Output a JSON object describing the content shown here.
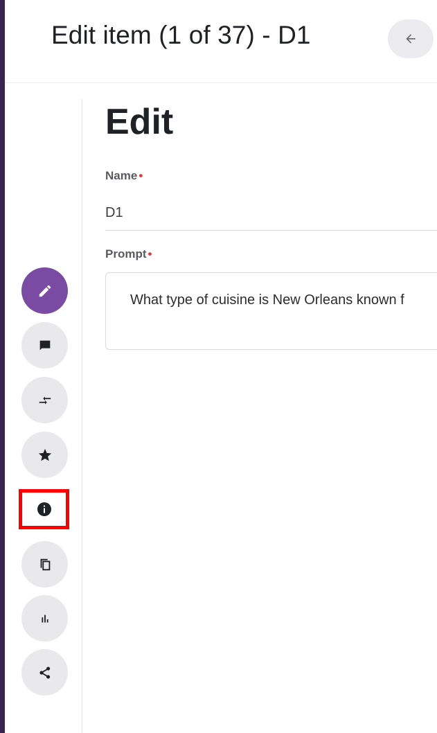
{
  "header": {
    "title": "Edit item (1 of 37) - D1",
    "back_icon": "arrow-left-icon"
  },
  "form": {
    "heading": "Edit",
    "name_label": "Name",
    "name_value": "D1",
    "prompt_label": "Prompt",
    "prompt_value": "What type of cuisine is New Orleans known f",
    "required_marker": "•"
  },
  "rail": {
    "items": [
      {
        "icon": "pencil-icon",
        "active": true
      },
      {
        "icon": "comment-icon",
        "active": false
      },
      {
        "icon": "compare-arrows-icon",
        "active": false
      },
      {
        "icon": "star-icon",
        "active": false
      },
      {
        "icon": "info-icon",
        "active": false,
        "highlighted": true
      },
      {
        "icon": "copy-icon",
        "active": false
      },
      {
        "icon": "bar-chart-icon",
        "active": false
      },
      {
        "icon": "share-icon",
        "active": false
      }
    ]
  },
  "colors": {
    "accent": "#7a4ba3",
    "rail_button_bg": "#e9e9ec",
    "highlight": "#ff0000",
    "required": "#e53935",
    "left_border": "#3b2350"
  }
}
